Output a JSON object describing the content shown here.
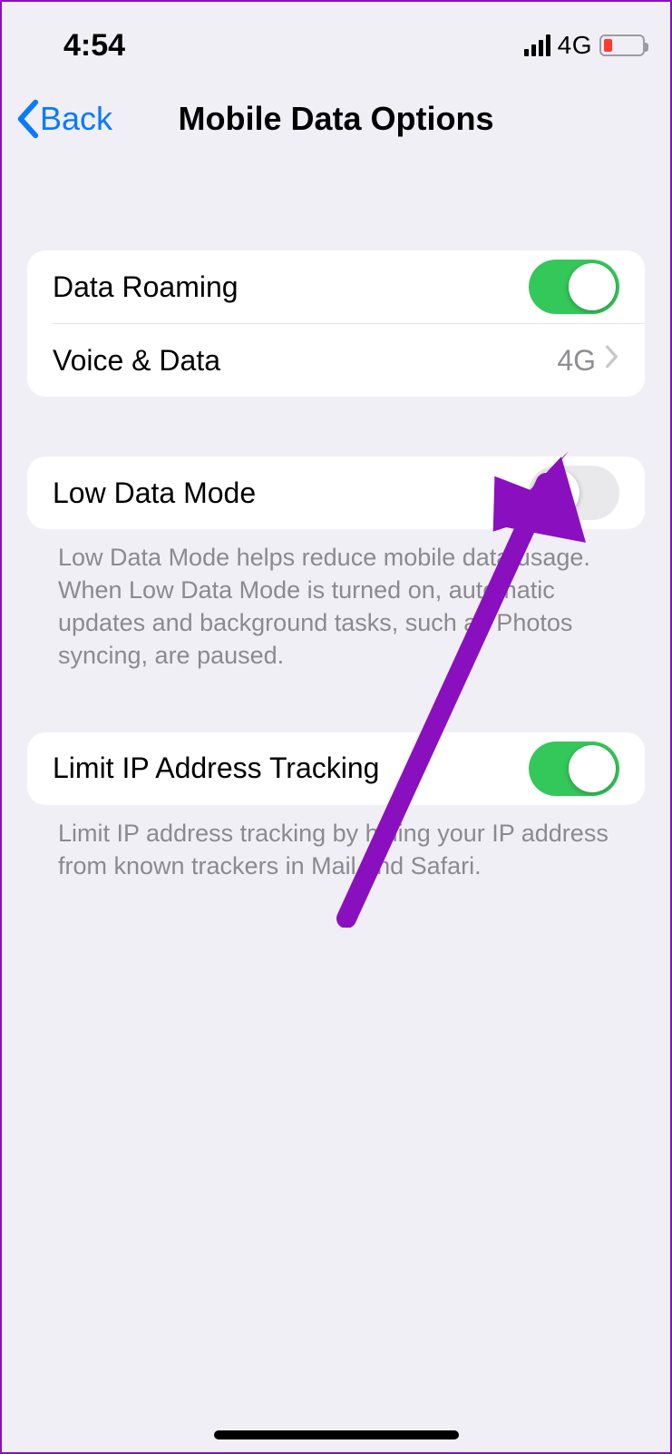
{
  "statusbar": {
    "time": "4:54",
    "network_label": "4G"
  },
  "navbar": {
    "back_label": "Back",
    "title": "Mobile Data Options"
  },
  "group1": {
    "data_roaming": {
      "label": "Data Roaming",
      "on": true
    },
    "voice_data": {
      "label": "Voice & Data",
      "value": "4G"
    }
  },
  "group2": {
    "low_data_mode": {
      "label": "Low Data Mode",
      "on": false
    },
    "footer": "Low Data Mode helps reduce mobile data usage. When Low Data Mode is turned on, automatic updates and background tasks, such as Photos syncing, are paused."
  },
  "group3": {
    "limit_ip": {
      "label": "Limit IP Address Tracking",
      "on": true
    },
    "footer": "Limit IP address tracking by hiding your IP address from known trackers in Mail and Safari."
  },
  "annotation": {
    "color": "#8a0fbf",
    "target": "low-data-mode-toggle"
  }
}
